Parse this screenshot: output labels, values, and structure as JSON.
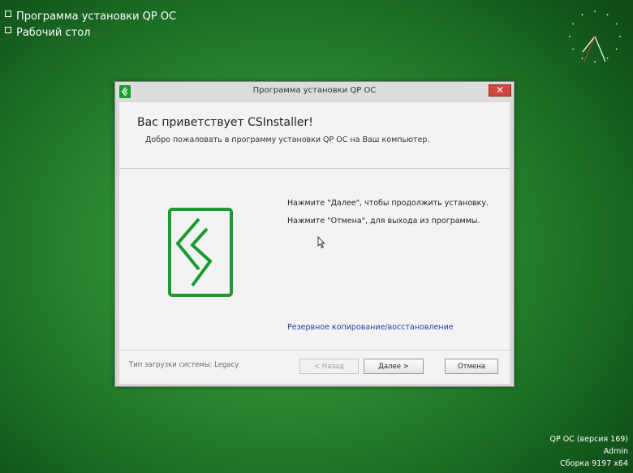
{
  "desktop": {
    "items": [
      {
        "label": "Программа установки QP OC"
      },
      {
        "label": "Рабочий стол"
      }
    ]
  },
  "system_info": {
    "line1": "QP OC (версия 169)",
    "line2": "Admin",
    "line3": "Сборка 9197 x64"
  },
  "window": {
    "title": "Программа установки QP OC",
    "close_label": "✕",
    "header_title": "Вас приветствует CSInstaller!",
    "header_subtitle": "Добро пожаловать в программу установки QP OC на Ваш компьютер.",
    "instruction_1": "Нажмите \"Далее\", чтобы продолжить установку.",
    "instruction_2": "Нажмите \"Отмена\", для выхода из программы.",
    "link_backup": "Резервное копирование/восстановление",
    "boot_type_label": "Тип загрузки системы:",
    "boot_type_value": "Legacy",
    "buttons": {
      "back": "< Назад",
      "next": "Далее >",
      "cancel": "Отмена"
    }
  },
  "colors": {
    "brand_green": "#1a9a2f",
    "close_red": "#d4453f",
    "link_blue": "#1f3fa8",
    "desktop_green": "#2e8f33"
  },
  "icons": {
    "logo": "chevron-logo-icon",
    "clock": "analog-clock-icon",
    "cursor": "mouse-pointer-icon"
  }
}
